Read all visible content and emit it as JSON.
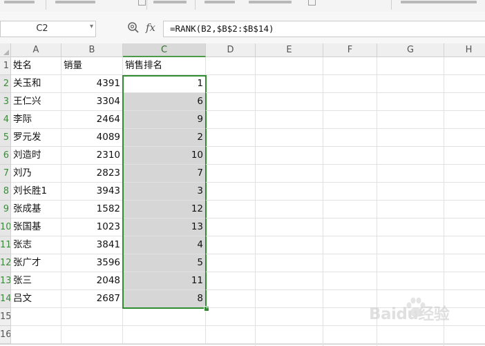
{
  "namebox": {
    "value": "C2"
  },
  "formula": {
    "fx_label": "fx",
    "text": "=RANK(B2,$B$2:$B$14)"
  },
  "columns": [
    "A",
    "B",
    "C",
    "D",
    "E",
    "F",
    "G",
    "H"
  ],
  "rows": [
    "1",
    "2",
    "3",
    "4",
    "5",
    "6",
    "7",
    "8",
    "9",
    "10",
    "11",
    "12",
    "13",
    "14",
    "15",
    "16"
  ],
  "header_row": {
    "name": "姓名",
    "sales": "销量",
    "rank": "销售排名"
  },
  "records": [
    {
      "name": "关玉和",
      "sales": "4391",
      "rank": "1"
    },
    {
      "name": "王仁兴",
      "sales": "3304",
      "rank": "6"
    },
    {
      "name": "李际",
      "sales": "2464",
      "rank": "9"
    },
    {
      "name": "罗元发",
      "sales": "4089",
      "rank": "2"
    },
    {
      "name": "刘造时",
      "sales": "2310",
      "rank": "10"
    },
    {
      "name": "刘乃",
      "sales": "2823",
      "rank": "7"
    },
    {
      "name": "刘长胜1",
      "sales": "3943",
      "rank": "3"
    },
    {
      "name": "张成基",
      "sales": "1582",
      "rank": "12"
    },
    {
      "name": "张国基",
      "sales": "1023",
      "rank": "13"
    },
    {
      "name": "张志",
      "sales": "3841",
      "rank": "4"
    },
    {
      "name": "张广才",
      "sales": "3596",
      "rank": "5"
    },
    {
      "name": "张三",
      "sales": "2048",
      "rank": "11"
    },
    {
      "name": "吕文",
      "sales": "2687",
      "rank": "8"
    }
  ],
  "watermark": {
    "text": "Baidu经验"
  },
  "colors": {
    "selection_border": "#2e8b2e",
    "selection_fill": "#d6d6d6"
  }
}
